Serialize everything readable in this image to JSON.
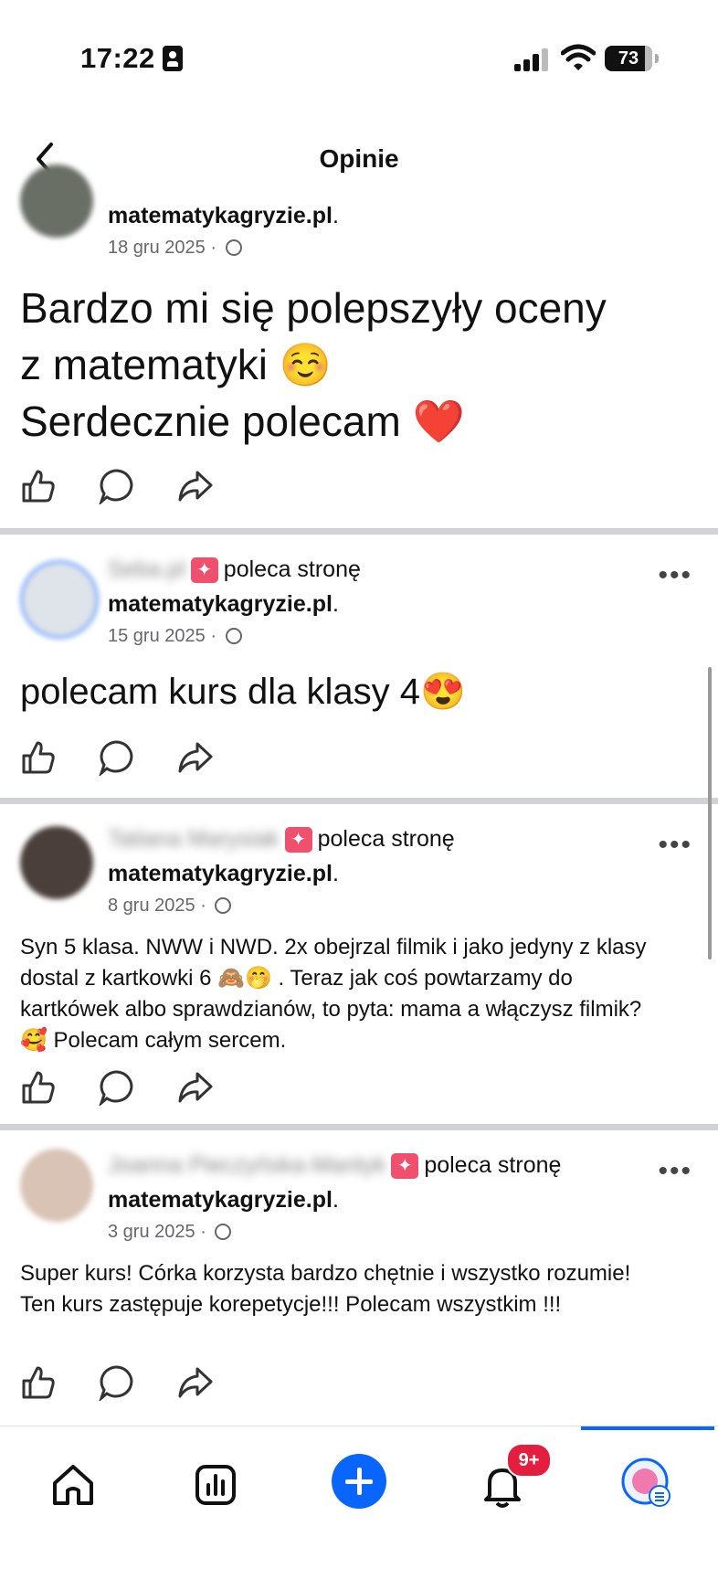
{
  "status_bar": {
    "time": "17:22",
    "battery": "73"
  },
  "nav": {
    "title": "Opinie"
  },
  "posts": [
    {
      "page": "matematykagryzie.pl",
      "date": "18 gru 2025",
      "text_lines": [
        "Bardzo mi się polepszyły oceny",
        "z matematyki ☺️",
        "Serdecznie polecam ❤️"
      ]
    },
    {
      "author": "Seba.pl",
      "recommends": "poleca stronę",
      "page": "matematykagryzie.pl",
      "date": "15 gru 2025",
      "text": "polecam kurs dla klasy 4😍"
    },
    {
      "author": "Tatiana Marysiak",
      "recommends": "poleca stronę",
      "page": "matematykagryzie.pl",
      "date": "8 gru 2025",
      "text": "Syn 5 klasa. NWW i NWD. 2x obejrzal filmik i jako jedyny z klasy dostal z kartkowki 6 🙈🤭 . Teraz jak coś powtarzamy do kartkówek albo sprawdzianów, to pyta: mama a włączysz filmik? 🥰 Polecam całym sercem."
    },
    {
      "author": "Joanna Pieczyńska-Mantyk",
      "recommends": "poleca stronę",
      "page": "matematykagryzie.pl",
      "date": "3 gru 2025",
      "text": "Super kurs! Córka korzysta bardzo chętnie i wszystko rozumie! Ten kurs zastępuje korepetycje!!! Polecam wszystkim !!!"
    }
  ],
  "tabbar": {
    "notifications_badge": "9+"
  },
  "colors": {
    "accent": "#0866ff",
    "badge": "#e41e3f",
    "recommend": "#f0506e",
    "separator": "#d0d2d6"
  }
}
